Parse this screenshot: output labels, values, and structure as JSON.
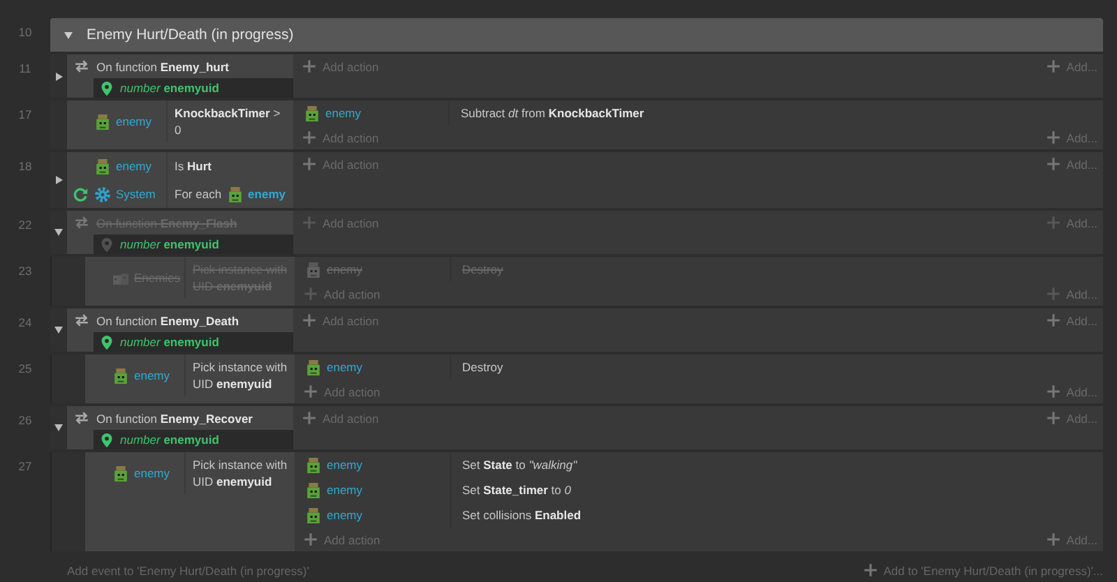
{
  "group": {
    "number": "10",
    "title": "Enemy Hurt/Death (in progress)",
    "expanded": true,
    "events": [
      {
        "kind": "function",
        "number": "11",
        "expanded": false,
        "disabled": false,
        "label": "On function",
        "name": "Enemy_hurt",
        "param": {
          "type": "number",
          "name": "enemyuid"
        },
        "add_action": "Add action",
        "add_more": "Add..."
      },
      {
        "kind": "event",
        "number": "17",
        "disabled": false,
        "conditions": [
          {
            "object": "enemy",
            "kind": "sprite",
            "loop": false,
            "text": "**KnockbackTimer** > 0"
          }
        ],
        "actions": [
          {
            "object": "enemy",
            "kind": "sprite",
            "text": "Subtract *dt* from **KnockbackTimer**"
          }
        ],
        "add_action": "Add action",
        "add_more": "Add..."
      },
      {
        "kind": "event",
        "number": "18",
        "expanded": false,
        "disabled": false,
        "conditions": [
          {
            "object": "enemy",
            "kind": "sprite",
            "loop": false,
            "text": "Is **Hurt**"
          },
          {
            "object": "System",
            "kind": "system",
            "loop": true,
            "text": "For each",
            "param_object": "enemy"
          }
        ],
        "add_action": "Add action",
        "add_more": "Add..."
      },
      {
        "kind": "function",
        "number": "22",
        "expanded": true,
        "disabled": true,
        "label": "On function",
        "name": "Enemy_Flash",
        "param": {
          "type": "number",
          "name": "enemyuid"
        },
        "add_action": "Add action",
        "add_more": "Add...",
        "children": [
          {
            "kind": "event",
            "number": "23",
            "disabled": true,
            "conditions": [
              {
                "object": "Enemies",
                "kind": "family",
                "loop": false,
                "text": "Pick instance with UID **enemyuid**"
              }
            ],
            "actions": [
              {
                "object": "enemy",
                "kind": "sprite",
                "text": "Destroy"
              }
            ],
            "add_action": "Add action",
            "add_more": "Add..."
          }
        ]
      },
      {
        "kind": "function",
        "number": "24",
        "expanded": true,
        "disabled": false,
        "label": "On function",
        "name": "Enemy_Death",
        "param": {
          "type": "number",
          "name": "enemyuid"
        },
        "add_action": "Add action",
        "add_more": "Add...",
        "children": [
          {
            "kind": "event",
            "number": "25",
            "disabled": false,
            "conditions": [
              {
                "object": "enemy",
                "kind": "sprite",
                "loop": false,
                "text": "Pick instance with UID **enemyuid**"
              }
            ],
            "actions": [
              {
                "object": "enemy",
                "kind": "sprite",
                "text": "Destroy"
              }
            ],
            "add_action": "Add action",
            "add_more": "Add..."
          }
        ]
      },
      {
        "kind": "function",
        "number": "26",
        "expanded": true,
        "disabled": false,
        "label": "On function",
        "name": "Enemy_Recover",
        "param": {
          "type": "number",
          "name": "enemyuid"
        },
        "add_action": "Add action",
        "add_more": "Add...",
        "children": [
          {
            "kind": "event",
            "number": "27",
            "disabled": false,
            "conditions": [
              {
                "object": "enemy",
                "kind": "sprite",
                "loop": false,
                "text": "Pick instance with UID **enemyuid**"
              }
            ],
            "actions": [
              {
                "object": "enemy",
                "kind": "sprite",
                "text": "Set **State** to *\"walking\"*"
              },
              {
                "object": "enemy",
                "kind": "sprite",
                "text": "Set **State_timer** to *0*"
              },
              {
                "object": "enemy",
                "kind": "sprite",
                "text": "Set collisions **Enabled**"
              }
            ],
            "add_action": "Add action",
            "add_more": "Add..."
          }
        ]
      }
    ]
  },
  "footer": {
    "add_event": "Add event to 'Enemy Hurt/Death (in progress)'",
    "add_to": "Add to 'Enemy Hurt/Death (in progress)'..."
  }
}
